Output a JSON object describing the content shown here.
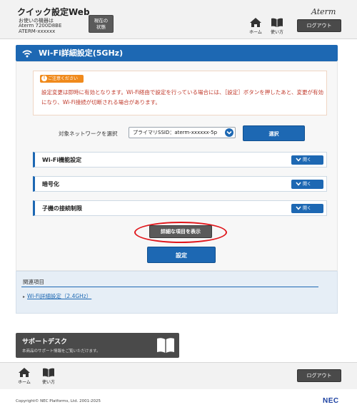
{
  "header": {
    "title": "クイック設定Web",
    "device_label": "お使いの機器は",
    "device_model": "Aterm 7200D8BE",
    "device_ssid": "ATERM-xxxxxx",
    "status_button_line1": "現在の",
    "status_button_line2": "状態",
    "brand": "Aterm",
    "home_label": "ホーム",
    "help_label": "使い方",
    "logout_label": "ログアウト"
  },
  "section": {
    "title": "Wi-Fi詳細設定(5GHz)"
  },
  "notice": {
    "badge": "ご注意ください",
    "text": "設定変更は即時に有効となります。Wi-Fi経由で設定を行っている場合には、［設定］ボタンを押したあと、変更が有効になり、Wi-Fi接続が切断される場合があります。"
  },
  "network": {
    "label": "対象ネットワークを選択",
    "selected": "プライマリSSID：aterm-xxxxxx-5p",
    "select_button": "選択"
  },
  "accordions": [
    {
      "title": "Wi-Fi機能設定",
      "open_label": "開く"
    },
    {
      "title": "暗号化",
      "open_label": "開く"
    },
    {
      "title": "子機の接続制限",
      "open_label": "開く"
    }
  ],
  "actions": {
    "detail_button": "詳細な項目を表示",
    "apply_button": "設定"
  },
  "related": {
    "title": "関連項目",
    "link": "Wi-Fi詳細設定（2.4GHz）"
  },
  "support": {
    "title": "サポートデスク",
    "description": "本商品のサポート情報をご覧いただけます。"
  },
  "footer": {
    "home_label": "ホーム",
    "help_label": "使い方",
    "logout_label": "ログアウト",
    "copyright": "Copyright© NEC Platforms, Ltd. 2001-2025",
    "logo": "NEC"
  },
  "colors": {
    "accent": "#1d68b3",
    "warning": "#f08a1c",
    "notice_text": "#c0392b",
    "highlight": "#e0161b",
    "dark_button": "#4a4a4a"
  }
}
